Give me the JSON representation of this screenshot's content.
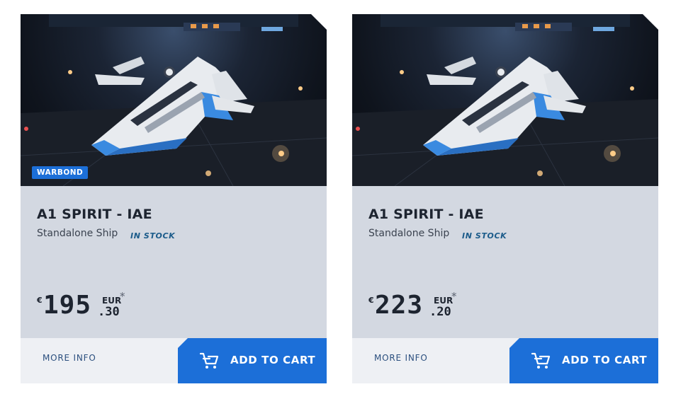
{
  "products": [
    {
      "badge": "WARBOND",
      "title": "A1 SPIRIT - IAE",
      "type": "Standalone Ship",
      "stock": "IN STOCK",
      "price": {
        "currency_symbol": "€",
        "amount": "195",
        "cents": ".30",
        "currency_code": "EUR",
        "asterisk": "*"
      },
      "more_info": "MORE INFO",
      "add_to_cart": "ADD TO CART"
    },
    {
      "title": "A1 SPIRIT - IAE",
      "type": "Standalone Ship",
      "stock": "IN STOCK",
      "price": {
        "currency_symbol": "€",
        "amount": "223",
        "cents": ".20",
        "currency_code": "EUR",
        "asterisk": "*"
      },
      "more_info": "MORE INFO",
      "add_to_cart": "ADD TO CART"
    }
  ],
  "colors": {
    "accent": "#1c6fd8",
    "card_bg": "#d3d8e1",
    "footer_bg": "#eef0f4",
    "stock_text": "#1b5b8a"
  },
  "icons": {
    "cart": "cart-icon",
    "image": "ship-image"
  }
}
